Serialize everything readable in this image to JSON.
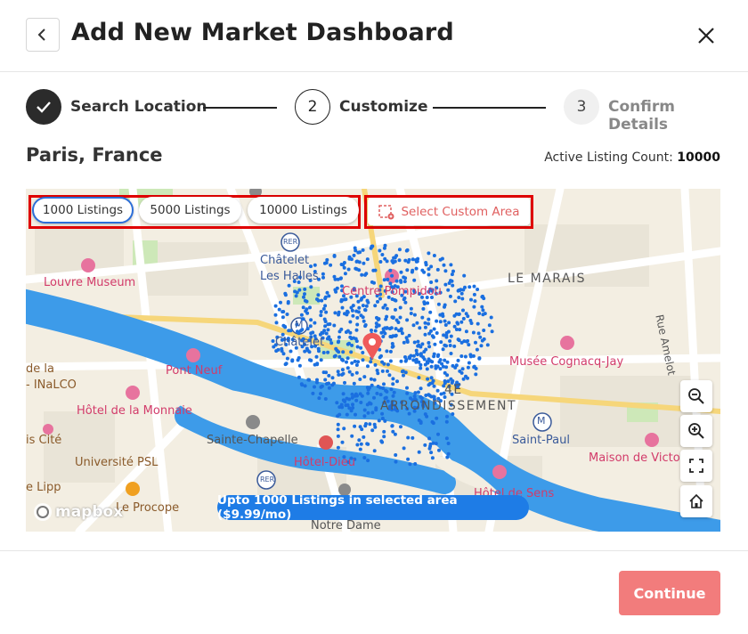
{
  "header": {
    "title": "Add New Market Dashboard"
  },
  "stepper": {
    "steps": [
      {
        "number": "1",
        "label": "Search Location",
        "state": "completed"
      },
      {
        "number": "2",
        "label": "Customize",
        "state": "active"
      },
      {
        "number": "3",
        "label": "Confirm Details",
        "state": "upcoming"
      }
    ]
  },
  "location": {
    "name": "Paris, France",
    "count_label": "Active Listing Count:",
    "count_value": "10000"
  },
  "map": {
    "listing_options": [
      {
        "label": "1000 Listings",
        "selected": true
      },
      {
        "label": "5000 Listings",
        "selected": false
      },
      {
        "label": "10000 Listings",
        "selected": false
      }
    ],
    "custom_area_label": "Select Custom Area",
    "info_badge": "Upto 1000 Listings in selected area ($9.99/mo)",
    "attribution": "mapbox",
    "labels": {
      "louvre": "Louvre Museum",
      "chatelet_les_halles_1": "Châtelet",
      "chatelet_les_halles_2": "Les Halles",
      "chatelet": "Châtelet",
      "pompidou": "Centre Pompidou",
      "le_marais": "LE MARAIS",
      "rue_amelot": "Rue Amelot",
      "pont_neuf": "Pont Neuf",
      "cognacq": "Musée Cognacq-Jay",
      "de_la": "de la",
      "inalco": "- INaLCO",
      "arrondissement_1": "4E",
      "arrondissement_2": "ARRONDISSEMENT",
      "monnaie": "Hôtel de la Monnaie",
      "cite": "is Cité",
      "sainte_chapelle": "Sainte-Chapelle",
      "saint_paul": "Saint-Paul",
      "universite": "Université PSL",
      "hotel_dieu": "Hôtel-Dieu",
      "maison_victor": "Maison de Victor",
      "lipp": "e Lipp",
      "procope": "Le Procope",
      "hotel_sens": "Hôtel de Sens",
      "notre_dame": "Notre Dame",
      "rer": "RER",
      "metro": "M"
    }
  },
  "footer": {
    "continue_label": "Continue"
  },
  "colors": {
    "accent_blue": "#1e7ce6",
    "continue_button": "#f27c7c",
    "highlight_red": "#e00000",
    "listing_dot": "#1a6fe0",
    "water": "#3d9be9"
  },
  "icons": {
    "back": "chevron-left-icon",
    "close": "close-icon",
    "check": "check-icon",
    "custom_area": "dashed-area-icon",
    "zoom_out": "zoom-out-icon",
    "zoom_in": "zoom-in-icon",
    "fullscreen": "fullscreen-icon",
    "home": "home-icon",
    "pin": "map-pin-icon"
  }
}
